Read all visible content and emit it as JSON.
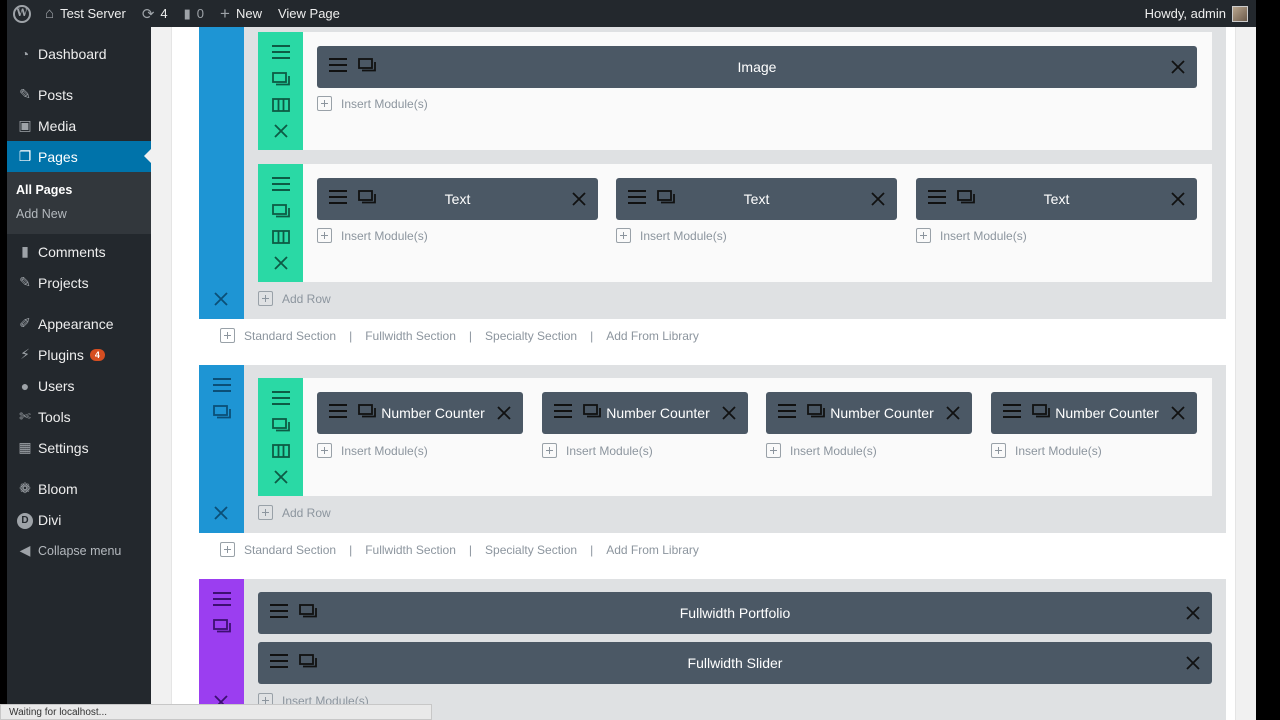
{
  "adminbar": {
    "site_name": "Test Server",
    "updates_count": "4",
    "comments_count": "0",
    "new_label": "New",
    "view_page_label": "View Page",
    "howdy": "Howdy, admin"
  },
  "sidebar": {
    "items": [
      {
        "label": "Dashboard",
        "icon": "dashboard-icon"
      },
      {
        "label": "Posts",
        "icon": "pin-icon"
      },
      {
        "label": "Media",
        "icon": "media-icon"
      },
      {
        "label": "Pages",
        "icon": "pages-icon"
      },
      {
        "label": "Comments",
        "icon": "comment-icon"
      },
      {
        "label": "Projects",
        "icon": "pin-icon"
      },
      {
        "label": "Appearance",
        "icon": "brush-icon"
      },
      {
        "label": "Plugins",
        "icon": "plugin-icon",
        "badge": "4"
      },
      {
        "label": "Users",
        "icon": "users-icon"
      },
      {
        "label": "Tools",
        "icon": "wrench-icon"
      },
      {
        "label": "Settings",
        "icon": "settings-icon"
      },
      {
        "label": "Bloom",
        "icon": "bloom-icon"
      },
      {
        "label": "Divi",
        "icon": "divi-icon"
      }
    ],
    "submenu": [
      "All Pages",
      "Add New"
    ],
    "collapse_label": "Collapse menu"
  },
  "builder": {
    "insert_label": "Insert Module(s)",
    "add_row_label": "Add Row",
    "section_links": [
      "Standard Section",
      "Fullwidth Section",
      "Specialty Section",
      "Add From Library"
    ],
    "section1": {
      "row1_modules": [
        "Image"
      ],
      "row2_modules": [
        "Text",
        "Text",
        "Text"
      ]
    },
    "section2": {
      "row_modules": [
        "Number Counter",
        "Number Counter",
        "Number Counter",
        "Number Counter"
      ]
    },
    "section3": {
      "modules": [
        "Fullwidth Portfolio",
        "Fullwidth Slider"
      ]
    }
  },
  "colors": {
    "section_blue": "#1e95d4",
    "row_green": "#2ad9a5",
    "fullwidth_purple": "#9b3ef0",
    "module_dark": "#4b5865",
    "admin_blue": "#0073aa"
  },
  "status_text": "Waiting for localhost..."
}
